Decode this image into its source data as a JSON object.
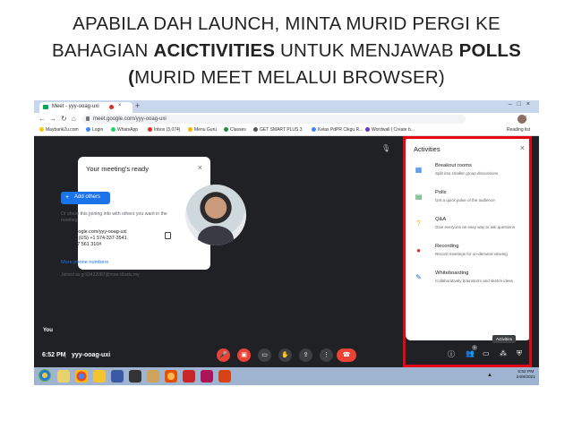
{
  "slide": {
    "title_line1": "APABILA DAH LAUNCH, MINTA MURID PERGI KE",
    "title_line2_a": "BAHAGIAN ",
    "title_line2_b": "ACICTIVITIES",
    "title_line2_c": " UNTUK MENJAWAB ",
    "title_line2_d": "POLLS",
    "title_line3_a": "(",
    "title_line3_b": "MURID MEET MELALUI BROWSER)"
  },
  "browser": {
    "tab_title": "Meet - yyy-ooag-uxi",
    "tab_close": "×",
    "new_tab": "+",
    "url": "meet.google.com/yyy-ooag-uxi",
    "bookmarks": [
      "Maybank2u.com",
      "Login",
      "WhatsApp",
      "Inbox (3,074)",
      "Menu Guru",
      "Classes",
      "GET SMART PLUS 3",
      "Kelas PdPR Cikgu R...",
      "Wordwall | Create b..."
    ],
    "reading_list": "Reading list"
  },
  "meeting_card": {
    "title": "Your meeting's ready",
    "add_button": "Add others",
    "share_text": "Or share this joining info with others you want in the meeting",
    "link": "meet.google.com/yyy-ooag-uxi",
    "dial_in_label": "Dial-in:",
    "dial_in": "(US) +1 574-337-3541",
    "pin_label": "PIN:",
    "pin": "717 561 310#",
    "more_phone": "More phone numbers",
    "joined_as": "Joined as g-93422087@moe-dl.edu.my",
    "close": "×"
  },
  "tile": {
    "self_label": "You"
  },
  "bottom_bar": {
    "time": "6:52 PM",
    "separator": "|",
    "meeting_code": "yyy-ooag-uxi",
    "participants_badge": "1"
  },
  "activities": {
    "title": "Activities",
    "close": "×",
    "tooltip": "Activities",
    "items": [
      {
        "name": "Breakout rooms",
        "desc": "Split into smaller group discussions",
        "color": "#1a73e8"
      },
      {
        "name": "Polls",
        "desc": "Get a quick pulse of the audience",
        "color": "#1e8e3e"
      },
      {
        "name": "Q&A",
        "desc": "Give everyone an easy way to ask questions",
        "color": "#f9ab00"
      },
      {
        "name": "Recording",
        "desc": "Record meetings for on-demand viewing",
        "color": "#d93025"
      },
      {
        "name": "Whiteboarding",
        "desc": "Collaboratively brainstorm and sketch ideas",
        "color": "#1a73e8"
      }
    ]
  },
  "taskbar": {
    "time": "6:52 PM",
    "date": "24/8/2021"
  },
  "colors": {
    "highlight": "#e30613",
    "meet_bg": "#202124",
    "accent": "#1a73e8",
    "end_call": "#ea4335"
  }
}
